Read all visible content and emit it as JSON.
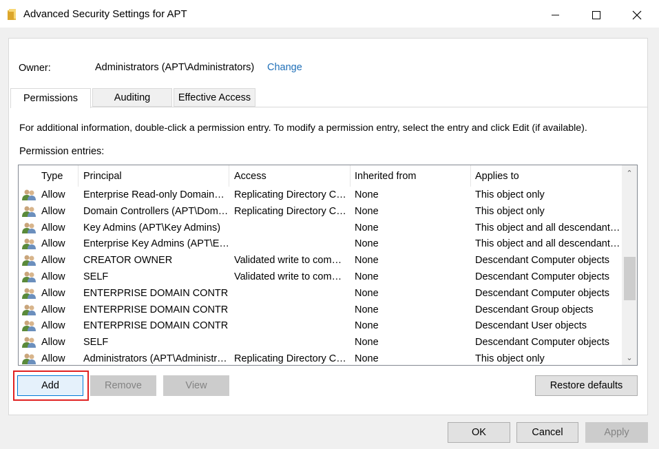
{
  "window": {
    "title": "Advanced Security Settings for APT",
    "minimize_icon": "minimize-icon",
    "maximize_icon": "maximize-icon",
    "close_icon": "close-icon"
  },
  "owner": {
    "label": "Owner:",
    "value": "Administrators (APT\\Administrators)",
    "change_link": "Change"
  },
  "tabs": [
    {
      "label": "Permissions",
      "active": true
    },
    {
      "label": "Auditing",
      "active": false
    },
    {
      "label": "Effective Access",
      "active": false
    }
  ],
  "info_text": "For additional information, double-click a permission entry. To modify a permission entry, select the entry and click Edit (if available).",
  "permission_entries_label": "Permission entries:",
  "table": {
    "columns": [
      "Type",
      "Principal",
      "Access",
      "Inherited from",
      "Applies to"
    ],
    "row_icon": "user-group-icon",
    "rows": [
      [
        "Allow",
        "Enterprise Read-only Domain…",
        "Replicating Directory C…",
        "None",
        "This object only"
      ],
      [
        "Allow",
        "Domain Controllers (APT\\Dom…",
        "Replicating Directory C…",
        "None",
        "This object only"
      ],
      [
        "Allow",
        "Key Admins (APT\\Key Admins)",
        "",
        "None",
        "This object and all descendant…"
      ],
      [
        "Allow",
        "Enterprise Key Admins (APT\\E…",
        "",
        "None",
        "This object and all descendant…"
      ],
      [
        "Allow",
        "CREATOR OWNER",
        "Validated write to com…",
        "None",
        "Descendant Computer objects"
      ],
      [
        "Allow",
        "SELF",
        "Validated write to com…",
        "None",
        "Descendant Computer objects"
      ],
      [
        "Allow",
        "ENTERPRISE DOMAIN CONTR…",
        "",
        "None",
        "Descendant Computer objects"
      ],
      [
        "Allow",
        "ENTERPRISE DOMAIN CONTR…",
        "",
        "None",
        "Descendant Group objects"
      ],
      [
        "Allow",
        "ENTERPRISE DOMAIN CONTR…",
        "",
        "None",
        "Descendant User objects"
      ],
      [
        "Allow",
        "SELF",
        "",
        "None",
        "Descendant Computer objects"
      ],
      [
        "Allow",
        "Administrators (APT\\Administr…",
        "Replicating Directory C…",
        "None",
        "This object only"
      ]
    ]
  },
  "buttons": {
    "add": "Add",
    "remove": "Remove",
    "view": "View",
    "restore_defaults": "Restore defaults",
    "ok": "OK",
    "cancel": "Cancel",
    "apply": "Apply"
  },
  "colors": {
    "link": "#1f6fb8",
    "highlight": "#e02020",
    "focus_border": "#0078d7"
  }
}
